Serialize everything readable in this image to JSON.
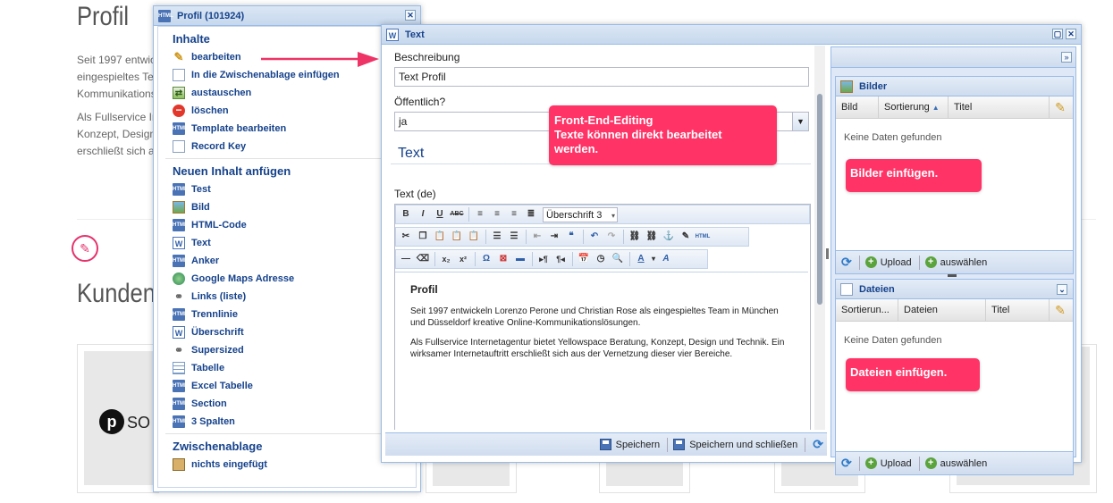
{
  "background": {
    "profil_title": "Profil",
    "kunden_title": "Kunden",
    "para1_line1": "Seit 1997 entwic",
    "para1_line2": "eingespieltes Te",
    "para1_line3": "Kommunikations",
    "para2_line1": "Als Fullservice In",
    "para2_line2": "Konzept, Design",
    "para2_line3": "erschließt sich a",
    "logo_text": "SO"
  },
  "left_panel": {
    "title": "Profil (101924)",
    "sections": [
      {
        "title": "Inhalte",
        "items": [
          {
            "label": "bearbeiten",
            "icon": "pencil-icon"
          },
          {
            "label": "In die Zwischenablage einfügen",
            "icon": "document-icon"
          },
          {
            "label": "austauschen",
            "icon": "swap-icon"
          },
          {
            "label": "löschen",
            "icon": "delete-icon"
          },
          {
            "label": "Template bearbeiten",
            "icon": "html-icon"
          },
          {
            "label": "Record Key",
            "icon": "document-icon"
          }
        ]
      },
      {
        "title": "Neuen Inhalt anfügen",
        "items": [
          {
            "label": "Test",
            "icon": "html-icon"
          },
          {
            "label": "Bild",
            "icon": "image-icon"
          },
          {
            "label": "HTML-Code",
            "icon": "html-icon"
          },
          {
            "label": "Text",
            "icon": "word-icon"
          },
          {
            "label": "Anker",
            "icon": "html-icon"
          },
          {
            "label": "Google Maps Adresse",
            "icon": "globe-icon"
          },
          {
            "label": "Links (liste)",
            "icon": "link-icon"
          },
          {
            "label": "Trennlinie",
            "icon": "html-icon"
          },
          {
            "label": "Überschrift",
            "icon": "word-icon"
          },
          {
            "label": "Supersized",
            "icon": "link-icon"
          },
          {
            "label": "Tabelle",
            "icon": "table-icon"
          },
          {
            "label": "Excel Tabelle",
            "icon": "html-icon"
          },
          {
            "label": "Section",
            "icon": "html-icon"
          },
          {
            "label": "3 Spalten",
            "icon": "html-icon"
          }
        ]
      },
      {
        "title": "Zwischenablage",
        "items": [
          {
            "label": "nichts eingefügt",
            "icon": "clipboard-icon"
          }
        ]
      }
    ]
  },
  "text_panel": {
    "title": "Text",
    "beschreibung_label": "Beschreibung",
    "beschreibung_value": "Text Profil",
    "oeffentlich_label": "Öffentlich?",
    "oeffentlich_value": "ja",
    "section_heading": "Text",
    "text_de_label": "Text (de)",
    "format_select": "Überschrift 3",
    "editor": {
      "heading": "Profil",
      "para1": "Seit 1997 entwickeln Lorenzo Perone und Christian Rose als eingespieltes Team in München und Düsseldorf kreative Online-Kommunikationslösungen.",
      "para2": "Als Fullservice Internetagentur bietet Yellowspace Beratung, Konzept, Design und Technik. Ein wirksamer Internetauftritt erschließt sich aus der Vernetzung dieser vier Bereiche."
    },
    "save_label": "Speichern",
    "save_close_label": "Speichern und schließen"
  },
  "bilder_panel": {
    "title": "Bilder",
    "columns": [
      "Bild",
      "Sortierung",
      "Titel"
    ],
    "empty_text": "Keine Daten gefunden",
    "upload_label": "Upload",
    "select_label": "auswählen"
  },
  "dateien_panel": {
    "title": "Dateien",
    "columns": [
      "Sortierun...",
      "Dateien",
      "Titel"
    ],
    "empty_text": "Keine Daten gefunden",
    "upload_label": "Upload",
    "select_label": "auswählen"
  },
  "callouts": {
    "front_end_line1": "Front-End-Editing",
    "front_end_line2": "Texte können direkt bearbeitet",
    "front_end_line3": "werden.",
    "bilder": "Bilder einfügen.",
    "dateien": "Dateien einfügen."
  },
  "colors": {
    "accent": "#ff3366",
    "panel_header_text": "#15428b",
    "panel_border": "#99bbe8"
  }
}
